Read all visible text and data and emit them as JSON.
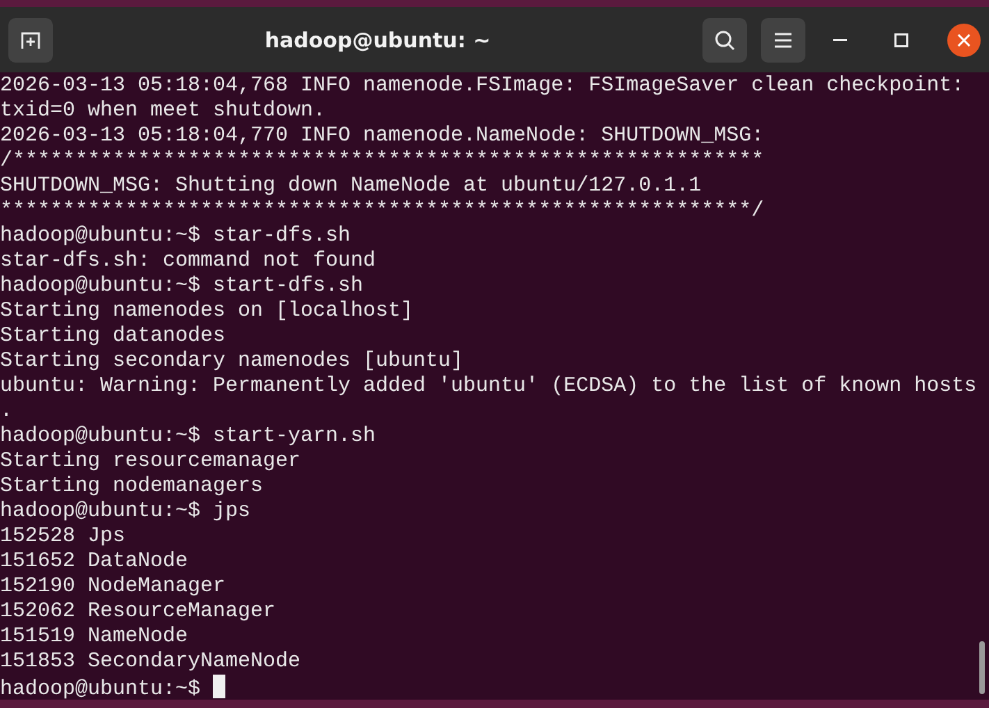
{
  "window": {
    "title": "hadoop@ubuntu: ~"
  },
  "terminal": {
    "lines": [
      "2026-03-13 05:18:04,768 INFO namenode.FSImage: FSImageSaver clean checkpoint:",
      "txid=0 when meet shutdown.",
      "2026-03-13 05:18:04,770 INFO namenode.NameNode: SHUTDOWN_MSG:",
      "/************************************************************",
      "SHUTDOWN_MSG: Shutting down NameNode at ubuntu/127.0.1.1",
      "************************************************************/",
      "hadoop@ubuntu:~$ star-dfs.sh",
      "star-dfs.sh: command not found",
      "hadoop@ubuntu:~$ start-dfs.sh",
      "Starting namenodes on [localhost]",
      "Starting datanodes",
      "Starting secondary namenodes [ubuntu]",
      "ubuntu: Warning: Permanently added 'ubuntu' (ECDSA) to the list of known hosts",
      ".",
      "hadoop@ubuntu:~$ start-yarn.sh",
      "Starting resourcemanager",
      "Starting nodemanagers",
      "hadoop@ubuntu:~$ jps",
      "152528 Jps",
      "151652 DataNode",
      "152190 NodeManager",
      "152062 ResourceManager",
      "151519 NameNode",
      "151853 SecondaryNameNode",
      "hadoop@ubuntu:~$ "
    ],
    "cursor": true
  }
}
